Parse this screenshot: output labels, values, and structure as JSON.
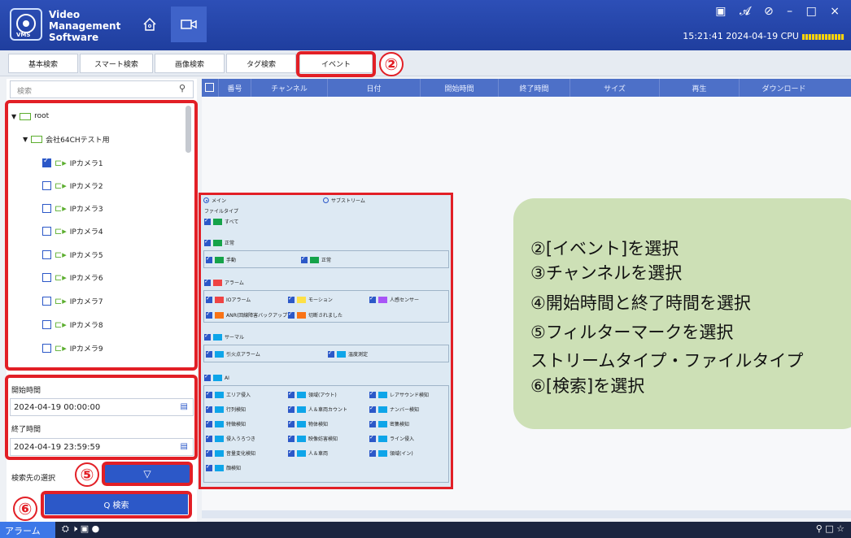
{
  "app": {
    "title": "Video Management Software",
    "logo_text": "VMS",
    "status_time": "15:21:41 2024-04-19 CPU",
    "window_controls": "▣ 𝓐 ⊘ – □ ×"
  },
  "tabs": [
    {
      "label": "基本検索"
    },
    {
      "label": "スマート検索"
    },
    {
      "label": "画像検索"
    },
    {
      "label": "タグ検索"
    },
    {
      "label": "イベント"
    }
  ],
  "search": {
    "placeholder": "検索"
  },
  "tree": {
    "root": "root",
    "group": "会社64CHテスト用",
    "cameras": [
      {
        "label": "IPカメラ1",
        "checked": true
      },
      {
        "label": "IPカメラ2",
        "checked": false
      },
      {
        "label": "IPカメラ3",
        "checked": false
      },
      {
        "label": "IPカメラ4",
        "checked": false
      },
      {
        "label": "IPカメラ5",
        "checked": false
      },
      {
        "label": "IPカメラ6",
        "checked": false
      },
      {
        "label": "IPカメラ7",
        "checked": false
      },
      {
        "label": "IPカメラ8",
        "checked": false
      },
      {
        "label": "IPカメラ9",
        "checked": false
      }
    ]
  },
  "time": {
    "start_label": "開始時間",
    "start_value": "2024-04-19 00:00:00",
    "end_label": "終了時間",
    "end_value": "2024-04-19 23:59:59"
  },
  "target_label": "検索先の選択",
  "search_button": "Q 検索",
  "table_headers": [
    "番号",
    "チャンネル",
    "日付",
    "開始時間",
    "終了時間",
    "サイズ",
    "再生",
    "ダウンロード"
  ],
  "filter_popup": {
    "stream_main": "メイン",
    "stream_sub": "サブストリーム",
    "file_type": "ファイルタイプ",
    "all": "すべて",
    "normal_group": "正常",
    "manual": "手動",
    "normal": "正常",
    "alarm_group": "アラーム",
    "io_alarm": "IOアラーム",
    "motion": "モーション",
    "human_sensor": "人感センサー",
    "anr": "ANR(回線障害バックアップ)",
    "disconnected": "切断されました",
    "thermal_group": "サーマル",
    "fire_alarm": "引火点アラーム",
    "temp_measure": "温度測定",
    "ai_group": "AI",
    "ai_items": [
      "エリア侵入",
      "領域(アウト)",
      "レアサウンド検知",
      "行列検知",
      "人＆車両カウント",
      "ナンバー検知",
      "特徴検知",
      "物体検知",
      "密集検知",
      "侵入うろつき",
      "映像妨害検知",
      "ライン侵入",
      "音量変化検知",
      "人＆車両",
      "領域(イン)",
      "顔検知"
    ]
  },
  "instructions": [
    "②[イベント]を選択",
    "③チャンネルを選択",
    "④開始時間と終了時間を選択",
    "⑤フィルターマークを選択",
    "  ストリームタイプ・ファイルタイプ",
    "⑥[検索]を選択"
  ],
  "badges": {
    "b2": "②",
    "b5": "⑤",
    "b6": "⑥"
  },
  "taskbar": {
    "left": "アラーム",
    "right": "⚲ □ ☆"
  },
  "colors": {
    "accent": "#2c58c8",
    "callout_red": "#e21f26",
    "info_card": "#cde0b6",
    "header_blue": "#4d70c8",
    "cpu": "#ffd400",
    "swatch_normal": "#16a34a",
    "swatch_alarm": "#ef4444",
    "swatch_motion": "#fde047",
    "swatch_human": "#a855f7",
    "swatch_anr": "#f97316",
    "swatch_disconnected": "#f97316",
    "swatch_ai": "#0ea5e9"
  }
}
